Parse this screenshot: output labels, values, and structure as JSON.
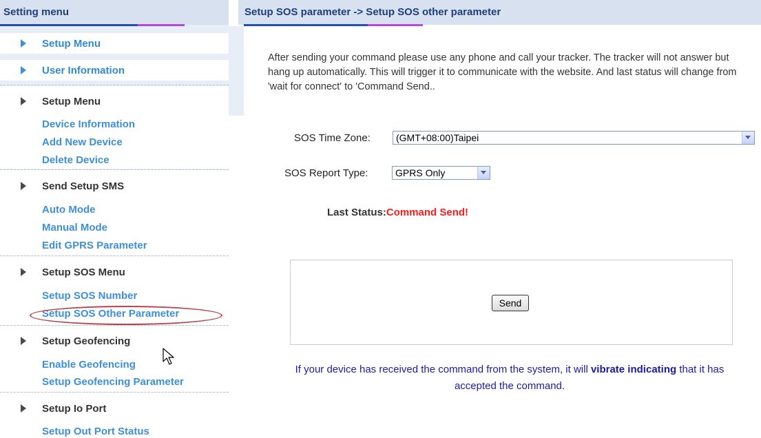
{
  "sidebar": {
    "title": "Setting menu",
    "top_items": [
      {
        "label": "Setup Menu"
      },
      {
        "label": "User Information"
      }
    ],
    "groups": [
      {
        "label": "Setup Menu",
        "links": [
          "Device Information",
          "Add New Device",
          "Delete Device"
        ]
      },
      {
        "label": "Send Setup SMS",
        "links": [
          "Auto Mode",
          "Manual Mode",
          "Edit GPRS Parameter"
        ]
      },
      {
        "label": "Setup SOS Menu",
        "links": [
          "Setup SOS Number",
          "Setup SOS Other Parameter"
        ]
      },
      {
        "label": "Setup Geofencing",
        "links": [
          "Enable Geofencing",
          "Setup Geofencing Parameter"
        ]
      },
      {
        "label": "Setup Io Port",
        "links": [
          "Setup Out Port Status"
        ]
      }
    ],
    "selected_link": "Setup SOS Other Parameter"
  },
  "main": {
    "title": "Setup SOS parameter -> Setup SOS other parameter",
    "instructions": "After sending your command please use any phone and call your tracker. The tracker will not answer but hang up automatically. This will trigger it to communicate with the website. And last status will change from 'wait for connect' to 'Command Send..",
    "time_zone": {
      "label": "SOS Time Zone:",
      "value": "(GMT+08:00)Taipei"
    },
    "report_type": {
      "label": "SOS Report Type:",
      "value": "GPRS Only"
    },
    "status": {
      "label": "Last Status:",
      "value": "Command Send!"
    },
    "send_label": "Send",
    "note": {
      "part1": "If your device has received the command from the system, it will ",
      "bold1": "vibrate indicating",
      "part2": " that it has accepted the command."
    }
  },
  "colors": {
    "header_bg": "#d7e1ef",
    "link_blue": "#3d8fd8",
    "status_red": "#ff1a1a",
    "note_blue": "#1a1aa8"
  }
}
